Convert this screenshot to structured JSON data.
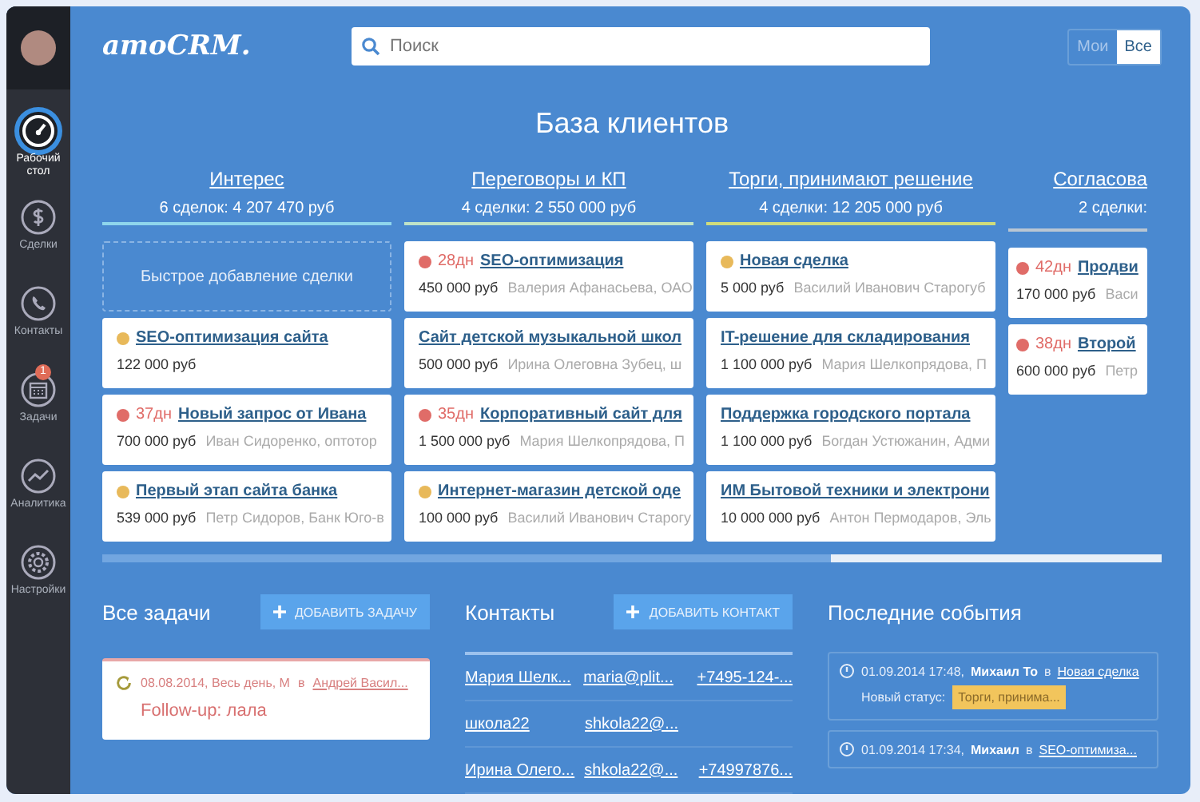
{
  "sidebar": {
    "items": [
      {
        "kind": "dashboard",
        "label": "Рабочий стол",
        "selected": true
      },
      {
        "kind": "deals",
        "label": "Сделки",
        "selected": false
      },
      {
        "kind": "contacts",
        "label": "Контакты",
        "selected": false
      },
      {
        "kind": "tasks",
        "label": "Задачи",
        "selected": false,
        "badge": "1"
      },
      {
        "kind": "analytics",
        "label": "Аналитика",
        "selected": false
      },
      {
        "kind": "settings",
        "label": "Настройки",
        "selected": false
      }
    ]
  },
  "header": {
    "logo": "amoCRM.",
    "search": {
      "placeholder": "Поиск"
    },
    "filter": [
      {
        "label": "Мои",
        "selected": false
      },
      {
        "label": "Все",
        "selected": true
      }
    ]
  },
  "title": "База клиентов",
  "stages": [
    {
      "name": "Интерес",
      "summary": "6 сделок: 4 207 470 руб",
      "color": "#8fd6ec",
      "cards": [
        {
          "kind": "quick_add",
          "text": "Быстрое добавление сделки"
        },
        {
          "kind": "deal",
          "color": "#e8b95a",
          "title": "SEO-оптимизация сайта",
          "price": "122 000 руб"
        },
        {
          "kind": "deal",
          "color": "#e06c68",
          "days": "37дн",
          "title": "Новый запрос от Ивана",
          "price": "700 000 руб",
          "contact": "Иван Сидоренко, оптотор"
        },
        {
          "kind": "deal",
          "color": "#e8b95a",
          "title": "Первый этап сайта банка",
          "price": "539 000 руб",
          "contact": "Петр Сидоров, Банк Юго-в"
        }
      ]
    },
    {
      "name": "Переговоры и КП",
      "summary": "4 сделки: 2 550 000 руб",
      "color": "#bfe3c8",
      "cards": [
        {
          "kind": "deal",
          "color": "#e06c68",
          "days": "28дн",
          "title": "SEO-оптимизация",
          "price": "450 000 руб",
          "contact": "Валерия Афанасьева, ОАО"
        },
        {
          "kind": "deal",
          "title": "Сайт детской музыкальной школ",
          "price": "500 000 руб",
          "contact": "Ирина Олеговна Зубец, ш"
        },
        {
          "kind": "deal",
          "color": "#e06c68",
          "days": "35дн",
          "title": "Корпоративный сайт для",
          "price": "1 500 000 руб",
          "contact": "Мария Шелкопрядова, П"
        },
        {
          "kind": "deal",
          "color": "#e8b95a",
          "title": "Интернет-магазин детской оде",
          "price": "100 000 руб",
          "contact": "Василий Иванович Старогу"
        }
      ]
    },
    {
      "name": "Торги, принимают решение",
      "summary": "4 сделки: 12 205 000 руб",
      "color": "#cfdc7c",
      "cards": [
        {
          "kind": "deal",
          "color": "#e8b95a",
          "title": "Новая сделка",
          "price": "5 000 руб",
          "contact": "Василий Иванович Старогуб"
        },
        {
          "kind": "deal",
          "title": "IT-решение для складирования",
          "price": "1 100 000 руб",
          "contact": "Мария Шелкопрядова, П"
        },
        {
          "kind": "deal",
          "title": "Поддержка городского портала",
          "price": "1 100 000 руб",
          "contact": "Богдан Устюжанин, Адми"
        },
        {
          "kind": "deal",
          "title": "ИМ Бытовой техники и электрони",
          "price": "10 000 000 руб",
          "contact": "Антон Пермодаров, Эль"
        }
      ]
    },
    {
      "name": "Согласова",
      "summary": "2 сделки:",
      "color": "#b9c6d3",
      "cards": [
        {
          "kind": "deal",
          "color": "#e06c68",
          "days": "42дн",
          "title": "Продви",
          "price": "170 000 руб",
          "contact": "Васи"
        },
        {
          "kind": "deal",
          "color": "#e06c68",
          "days": "38дн",
          "title": "Второй",
          "price": "600 000 руб",
          "contact": "Петр"
        }
      ]
    }
  ],
  "tasks": {
    "title": "Все задачи",
    "add_button": "ДОБАВИТЬ ЗАДАЧУ",
    "items": [
      {
        "overdue": true,
        "when": "08.08.2014, Весь день, М",
        "prep": "в",
        "link": "Андрей Васил...",
        "text": "Follow-up: лала"
      }
    ]
  },
  "contacts": {
    "title": "Контакты",
    "add_button": "ДОБАВИТЬ КОНТАКТ",
    "rows": [
      {
        "name": "Мария Шелк...",
        "email": "maria@plit...",
        "phone": "+7495-124-..."
      },
      {
        "name": "школа22",
        "email": "shkola22@..."
      },
      {
        "name": "Ирина Олего...",
        "email": "shkola22@...",
        "phone": "+74997876..."
      }
    ]
  },
  "events": {
    "title": "Последние события",
    "items": [
      {
        "when": "01.09.2014 17:48,",
        "user": "Михаил То",
        "prep": "в",
        "link": "Новая сделка",
        "status_label": "Новый статус:",
        "status": "Торги, принима..."
      },
      {
        "when": "01.09.2014 17:34,",
        "user": "Михаил",
        "prep": "в",
        "link": "SEO-оптимиза..."
      }
    ]
  }
}
